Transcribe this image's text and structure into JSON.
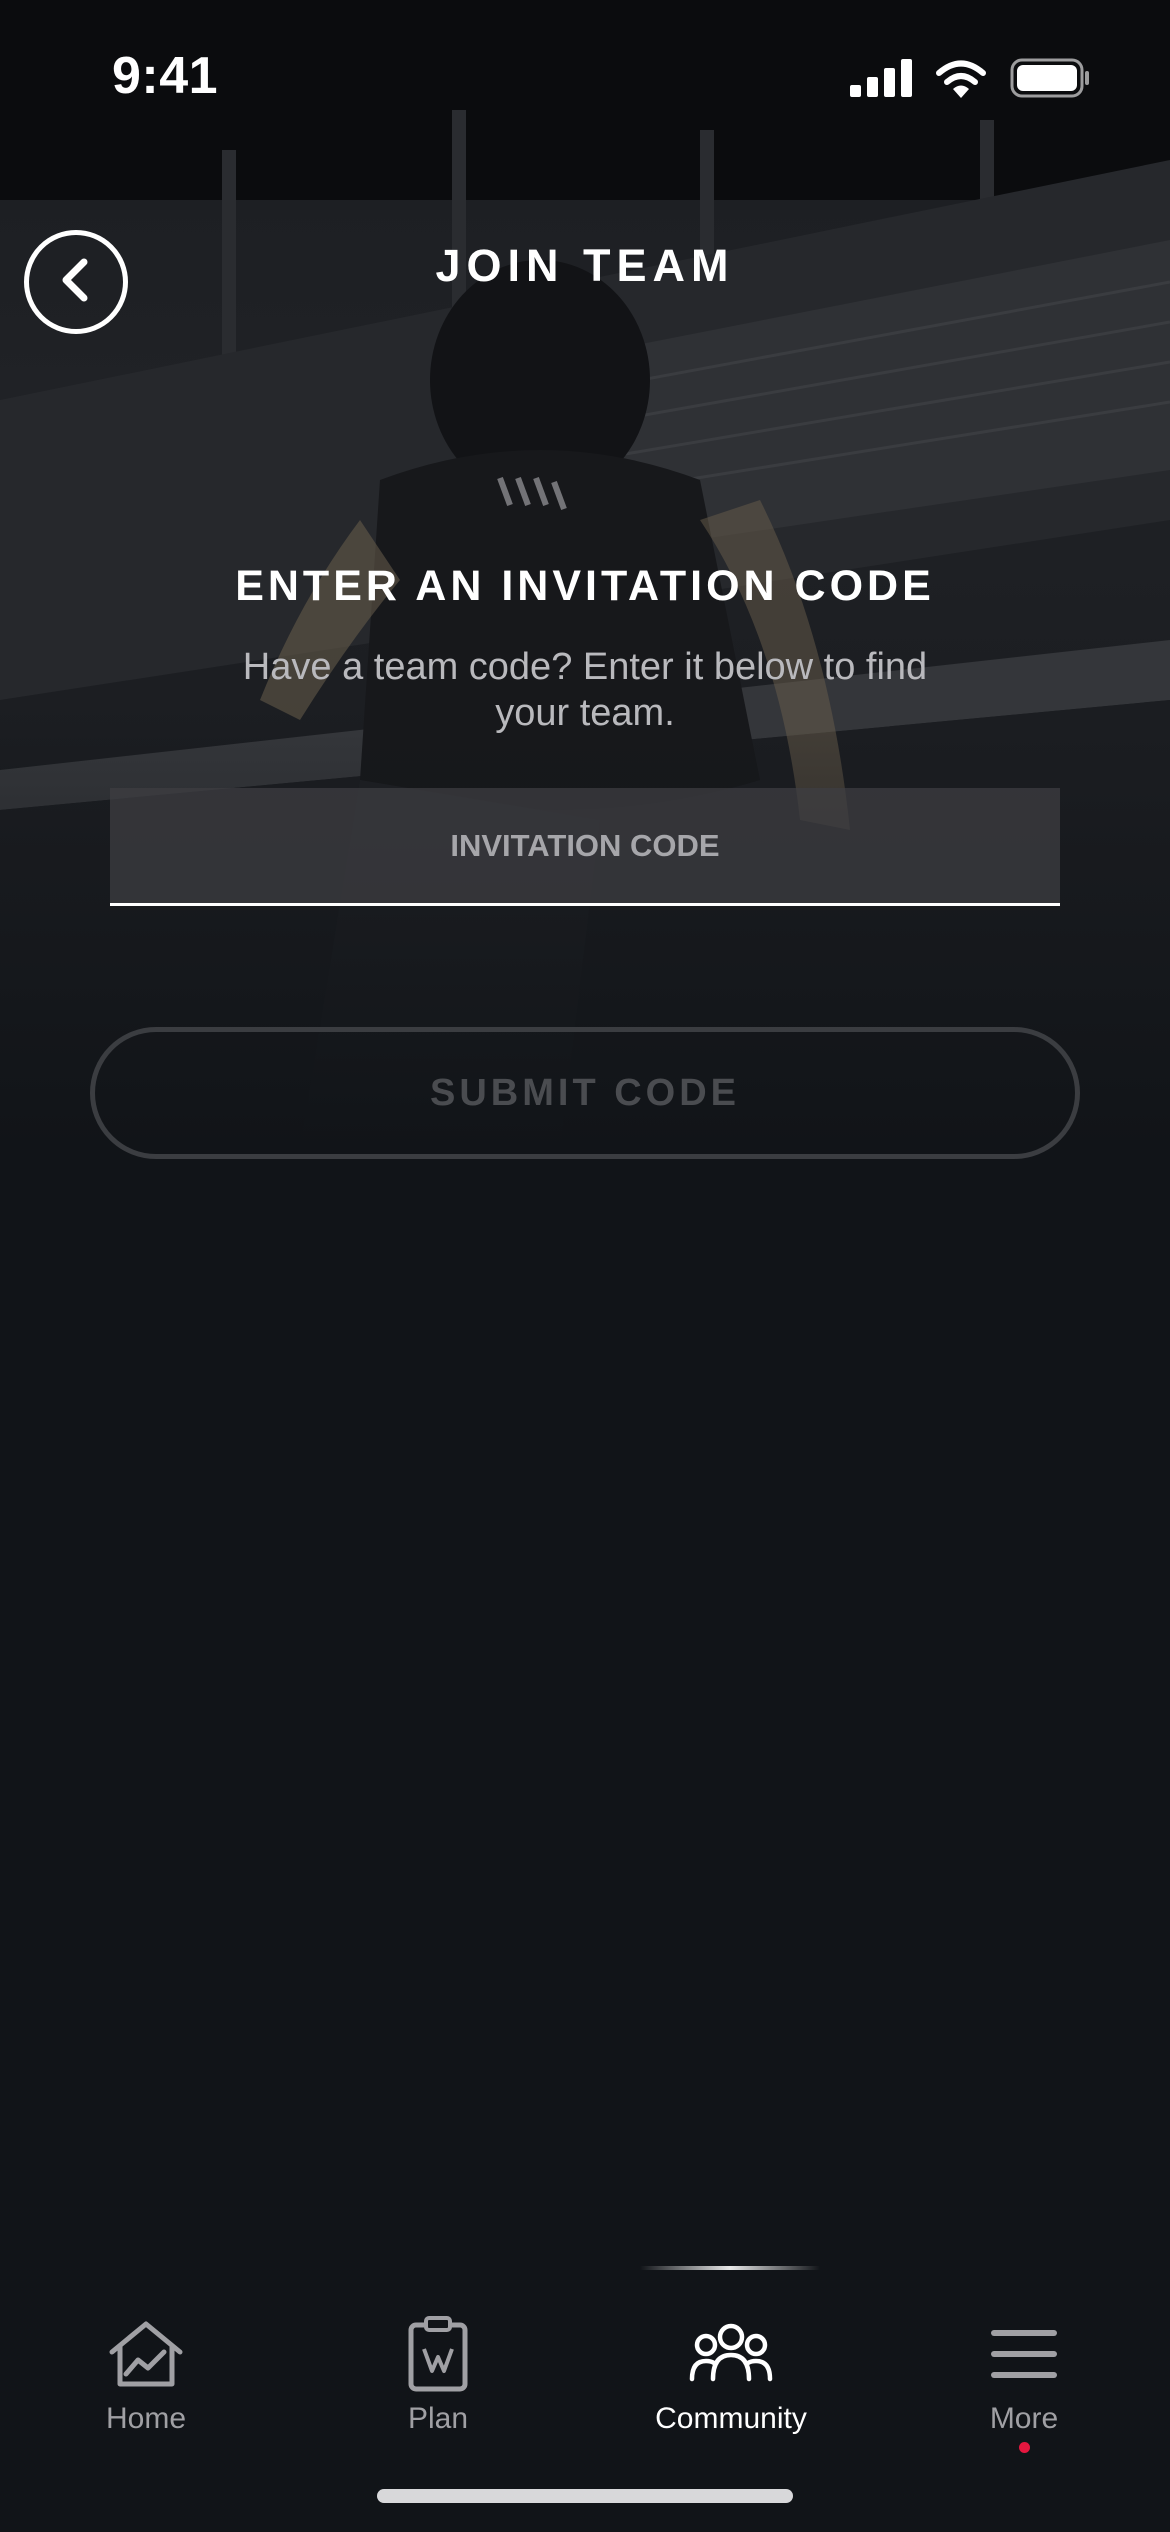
{
  "status_bar": {
    "time": "9:41",
    "icons": [
      "cellular-signal-icon",
      "wifi-icon",
      "battery-icon"
    ]
  },
  "header": {
    "back_icon": "chevron-left-icon",
    "title": "JOIN TEAM"
  },
  "main": {
    "heading": "ENTER AN INVITATION CODE",
    "subtitle": "Have a team code? Enter it below to find your team.",
    "code_input": {
      "value": "",
      "placeholder": "INVITATION CODE"
    },
    "submit_label": "SUBMIT CODE"
  },
  "tab_bar": {
    "items": [
      {
        "label": "Home",
        "icon": "home-chart-icon",
        "active": false
      },
      {
        "label": "Plan",
        "icon": "clipboard-icon",
        "active": false
      },
      {
        "label": "Community",
        "icon": "people-group-icon",
        "active": true
      },
      {
        "label": "More",
        "icon": "menu-icon",
        "active": false,
        "notification": true
      }
    ]
  },
  "colors": {
    "background": "#111418",
    "text_primary": "#ffffff",
    "text_muted": "#a0a0a4",
    "button_disabled": "#4a4c50",
    "notification": "#e5173f"
  }
}
